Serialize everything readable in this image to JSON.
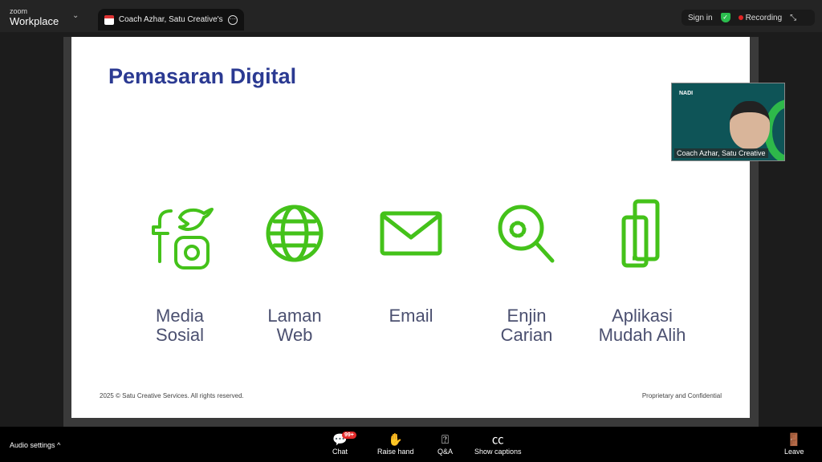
{
  "app": {
    "brand_small": "zoom",
    "brand_large": "Workplace"
  },
  "tab": {
    "title": "Coach Azhar, Satu Creative's screen"
  },
  "topright": {
    "sign_in": "Sign in",
    "recording": "Recording"
  },
  "slide": {
    "title": "Pemasaran Digital",
    "items": [
      {
        "icon": "social-media-icon",
        "line1": "Media",
        "line2": "Sosial"
      },
      {
        "icon": "globe-icon",
        "line1": "Laman",
        "line2": "Web"
      },
      {
        "icon": "envelope-icon",
        "line1": "Email",
        "line2": ""
      },
      {
        "icon": "search-gear-icon",
        "line1": "Enjin",
        "line2": "Carian"
      },
      {
        "icon": "mobile-devices-icon",
        "line1": "Aplikasi",
        "line2": "Mudah Alih"
      }
    ],
    "footer_left": "2025 © Satu Creative Services. All rights reserved.",
    "footer_right": "Proprietary and Confidential",
    "colors": {
      "title": "#2b3a92",
      "icon": "#44c21a",
      "label": "#4b5070"
    }
  },
  "video": {
    "logo": "NADI",
    "name": "Coach Azhar, Satu Creative"
  },
  "toolbar": {
    "audio_settings": "Audio settings",
    "chat": "Chat",
    "chat_badge": "99+",
    "raise_hand": "Raise hand",
    "qa": "Q&A",
    "captions": "Show captions",
    "leave": "Leave"
  }
}
